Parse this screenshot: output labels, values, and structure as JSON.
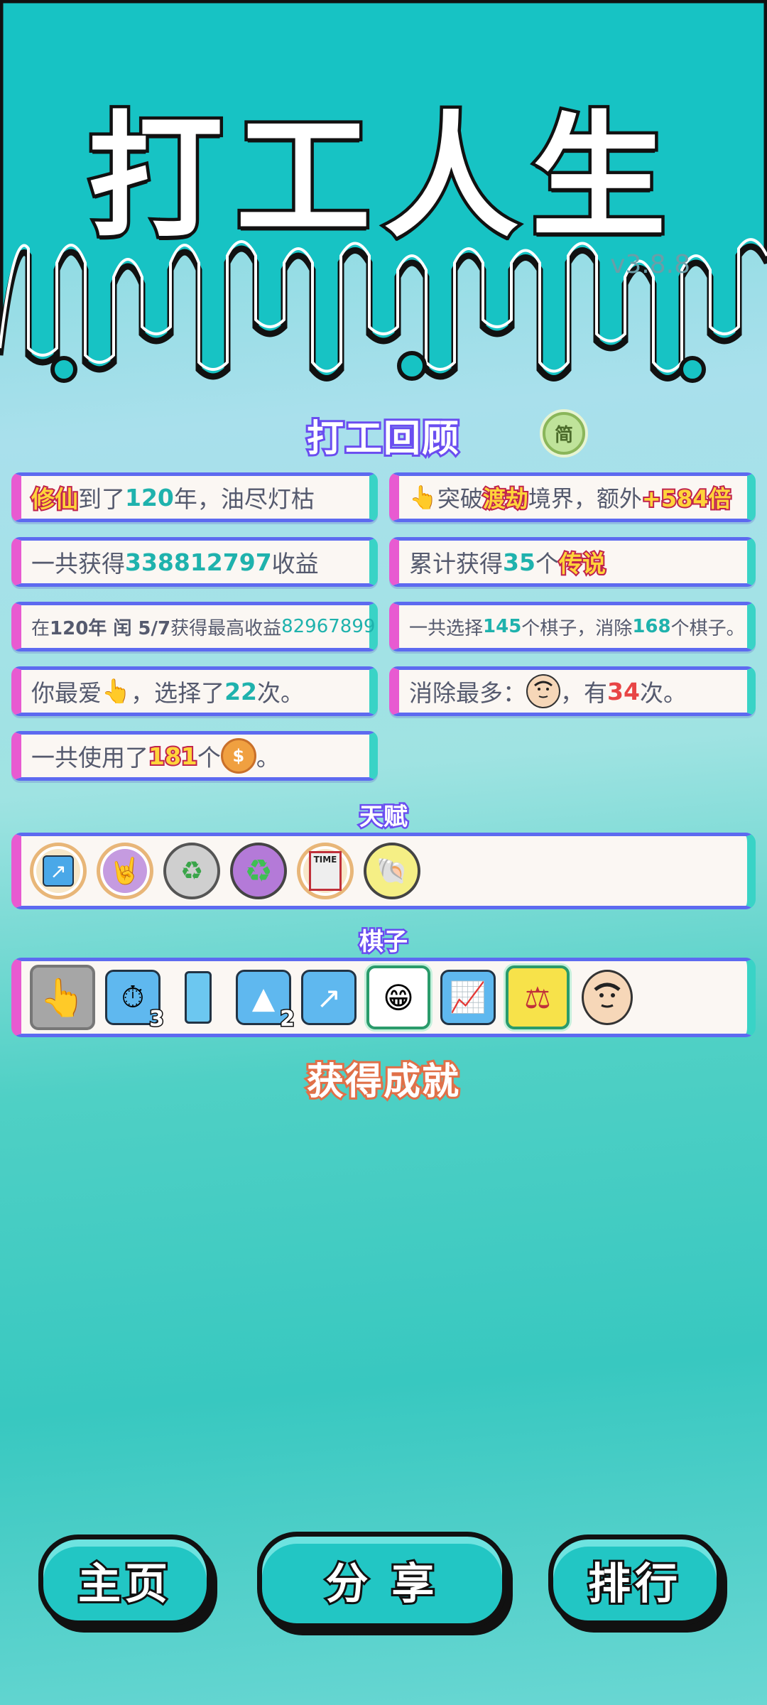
{
  "app": {
    "title": "打工人生",
    "version": "v3.8.8"
  },
  "review": {
    "title": "打工回顾",
    "toggle": "简",
    "cards": {
      "c1": {
        "hl": "修仙",
        "a": "到了",
        "n": "120",
        "b": "年，油尽灯枯"
      },
      "c2": {
        "icon": "👆",
        "a": "突破",
        "hl": "渡劫",
        "b": "境界，额外",
        "hl2": "+584倍"
      },
      "c3": {
        "a": "一共获得",
        "n": "338812797",
        "b": "收益"
      },
      "c4": {
        "a": "累计获得",
        "n": "35",
        "b": "个",
        "hl": "传说"
      },
      "c5": {
        "a": "在 ",
        "y": "120年 闰 5/7",
        "b": " 获得最高收益",
        "n": "82967899"
      },
      "c6": {
        "a": "一共选择",
        "n1": "145",
        "b": "个棋子，消除",
        "n2": "168",
        "c": "个棋子。"
      },
      "c7": {
        "a": "你最爱",
        "icon": "👆",
        "b": "，选择了",
        "n": "22",
        "c": "次。"
      },
      "c8": {
        "a": "消除最多：",
        "b": "，有",
        "n": "34",
        "c": "次。"
      },
      "c9": {
        "a": "一共使用了",
        "hl": "181",
        "b": "个",
        "coin": "$",
        "c": "。"
      }
    }
  },
  "talents": {
    "title": "天赋",
    "items": [
      {
        "name": "bow-talent",
        "glyph": "↗"
      },
      {
        "name": "rock-hand-talent",
        "glyph": "🤘"
      },
      {
        "name": "recycle-arrows-talent",
        "glyph": "♻"
      },
      {
        "name": "recycle-talent",
        "glyph": "♻"
      },
      {
        "name": "time-magazine-talent",
        "glyph": "TIME"
      },
      {
        "name": "shell-talent",
        "glyph": "🐚"
      }
    ]
  },
  "pieces": {
    "title": "棋子",
    "items": [
      {
        "name": "hand-piece",
        "glyph": "👆",
        "count": ""
      },
      {
        "name": "stopwatch-piece",
        "glyph": "⏱",
        "count": "3"
      },
      {
        "name": "phone-piece",
        "glyph": "▯",
        "count": ""
      },
      {
        "name": "gold-bars-piece",
        "glyph": "▲",
        "count": "2"
      },
      {
        "name": "trend-piece",
        "glyph": "↗",
        "count": ""
      },
      {
        "name": "old-man-piece",
        "glyph": "😁",
        "count": ""
      },
      {
        "name": "chart-piece",
        "glyph": "📈",
        "count": ""
      },
      {
        "name": "scale-piece",
        "glyph": "⚖",
        "count": ""
      },
      {
        "name": "face-piece",
        "glyph": "😐",
        "count": ""
      }
    ]
  },
  "achievements": {
    "title": "获得成就"
  },
  "buttons": {
    "home": "主页",
    "share": "分 享",
    "rank": "排行"
  }
}
